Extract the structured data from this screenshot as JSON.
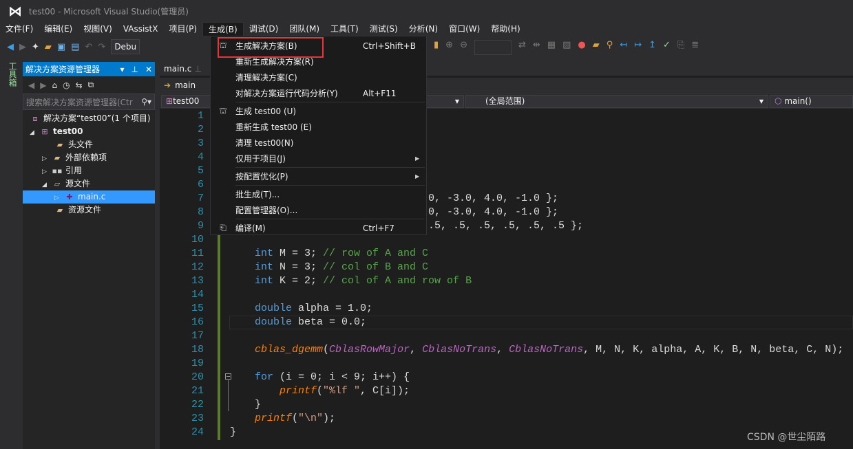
{
  "window": {
    "title": "test00 - Microsoft Visual Studio(管理员)"
  },
  "menubar": [
    "文件(F)",
    "编辑(E)",
    "视图(V)",
    "VAssistX",
    "项目(P)",
    "生成(B)",
    "调试(D)",
    "团队(M)",
    "工具(T)",
    "测试(S)",
    "分析(N)",
    "窗口(W)",
    "帮助(H)"
  ],
  "toolbar": {
    "config": "Debu"
  },
  "toolbox": {
    "label": "工具箱"
  },
  "solution_explorer": {
    "title": "解决方案资源管理器",
    "search_placeholder": "搜索解决方案资源管理器(Ctr",
    "items": [
      {
        "label": "解决方案“test00”(1 个项目)",
        "icon": "solution-icon"
      },
      {
        "label": "test00",
        "icon": "project-icon"
      },
      {
        "label": "头文件",
        "icon": "folder-icon"
      },
      {
        "label": "外部依赖项",
        "icon": "folder-link-icon"
      },
      {
        "label": "引用",
        "icon": "reference-icon"
      },
      {
        "label": "源文件",
        "icon": "folder-open-icon"
      },
      {
        "label": "main.c",
        "icon": "cpp-file-icon",
        "selected": true
      },
      {
        "label": "资源文件",
        "icon": "folder-icon"
      }
    ]
  },
  "editor": {
    "tab": "main.c",
    "nav_function": "main",
    "project_dropdown": "test00",
    "scope_dropdown": "(全局范围)",
    "member_dropdown": "main()",
    "line_numbers": [
      "1",
      "2",
      "3",
      "4",
      "5",
      "6",
      "7",
      "8",
      "9",
      "10",
      "11",
      "12",
      "13",
      "14",
      "15",
      "16",
      "17",
      "18",
      "19",
      "20",
      "21",
      "22",
      "23",
      "24"
    ],
    "partial": {
      "l7": "0, -3.0, 4.0, -1.0 };",
      "l8": "0, -3.0, 4.0, -1.0 };",
      "l9": ".5, .5, .5, .5, .5, .5 };"
    },
    "l11": {
      "kw": "int",
      "rest": " M = 3; ",
      "cm": "// row of A and C"
    },
    "l12": {
      "kw": "int",
      "rest": " N = 3; ",
      "cm": "// col of B and C"
    },
    "l13": {
      "kw": "int",
      "rest": " K = 2; ",
      "cm": "// col of A and row of B"
    },
    "l15": {
      "kw": "double",
      "rest": " alpha = 1.0;"
    },
    "l16": {
      "kw": "double",
      "rest": " beta = 0.0;"
    },
    "l18": {
      "fn": "cblas_dgemm",
      "p": "(",
      "a1": "CblasRowMajor",
      "c1": ", ",
      "a2": "CblasNoTrans",
      "c2": ", ",
      "a3": "CblasNoTrans",
      "rest": ", M, N, K, alpha, A, K, B, N, beta, C, N);"
    },
    "l20": {
      "kw": "for",
      "rest": " (i = 0; i < 9; i++) {"
    },
    "l21": {
      "fn": "printf",
      "p": "(",
      "str": "\"%lf \"",
      "rest": ", C[i]);"
    },
    "l22": "}",
    "l23": {
      "fn": "printf",
      "p": "(",
      "str": "\"\\n\"",
      "rest": ");"
    },
    "l24": "}"
  },
  "build_menu": {
    "items": [
      {
        "label": "生成解决方案(B)",
        "shortcut": "Ctrl+Shift+B",
        "icon": "build-icon",
        "highlighted": true
      },
      {
        "label": "重新生成解决方案(R)",
        "shortcut": ""
      },
      {
        "label": "清理解决方案(C)",
        "shortcut": ""
      },
      {
        "label": "对解决方案运行代码分析(Y)",
        "shortcut": "Alt+F11"
      },
      {
        "label": "生成 test00 (U)",
        "shortcut": "",
        "icon": "build-icon"
      },
      {
        "label": "重新生成 test00 (E)",
        "shortcut": ""
      },
      {
        "label": "清理 test00(N)",
        "shortcut": ""
      },
      {
        "label": "仅用于项目(J)",
        "shortcut": "",
        "submenu": true
      },
      {
        "label": "按配置优化(P)",
        "shortcut": "",
        "submenu": true
      },
      {
        "label": "批生成(T)...",
        "shortcut": ""
      },
      {
        "label": "配置管理器(O)...",
        "shortcut": ""
      },
      {
        "label": "编译(M)",
        "shortcut": "Ctrl+F7",
        "icon": "compile-icon"
      }
    ]
  },
  "highlight_color": "#e8353a",
  "accent_color": "#007acc",
  "watermark": "CSDN @世尘陌路"
}
